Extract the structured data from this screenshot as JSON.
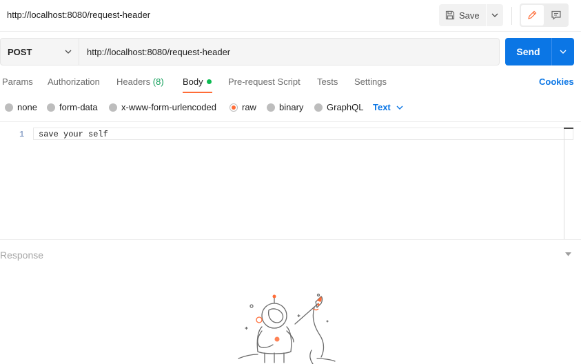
{
  "window": {
    "title": "http://localhost:8080/request-header"
  },
  "toolbar": {
    "save_label": "Save",
    "save_icon": "floppy-disk-icon",
    "modes": [
      "pencil-icon",
      "comment-icon"
    ]
  },
  "request": {
    "method": "POST",
    "url": "http://localhost:8080/request-header",
    "send_label": "Send"
  },
  "tabs": {
    "params": "Params",
    "authorization": "Authorization",
    "headers_label": "Headers",
    "headers_count": "(8)",
    "body": "Body",
    "prerequest": "Pre-request Script",
    "tests": "Tests",
    "settings": "Settings",
    "cookies": "Cookies",
    "active": "Body"
  },
  "body_types": {
    "options": [
      "none",
      "form-data",
      "x-www-form-urlencoded",
      "raw",
      "binary",
      "GraphQL"
    ],
    "selected": "raw",
    "language": "Text"
  },
  "editor": {
    "line_number": "1",
    "content": "save your self"
  },
  "response": {
    "label": "Response"
  },
  "colors": {
    "accent_orange": "#ff6c37",
    "send_blue": "#0b76e5",
    "body_dot_green": "#0cbb52"
  }
}
